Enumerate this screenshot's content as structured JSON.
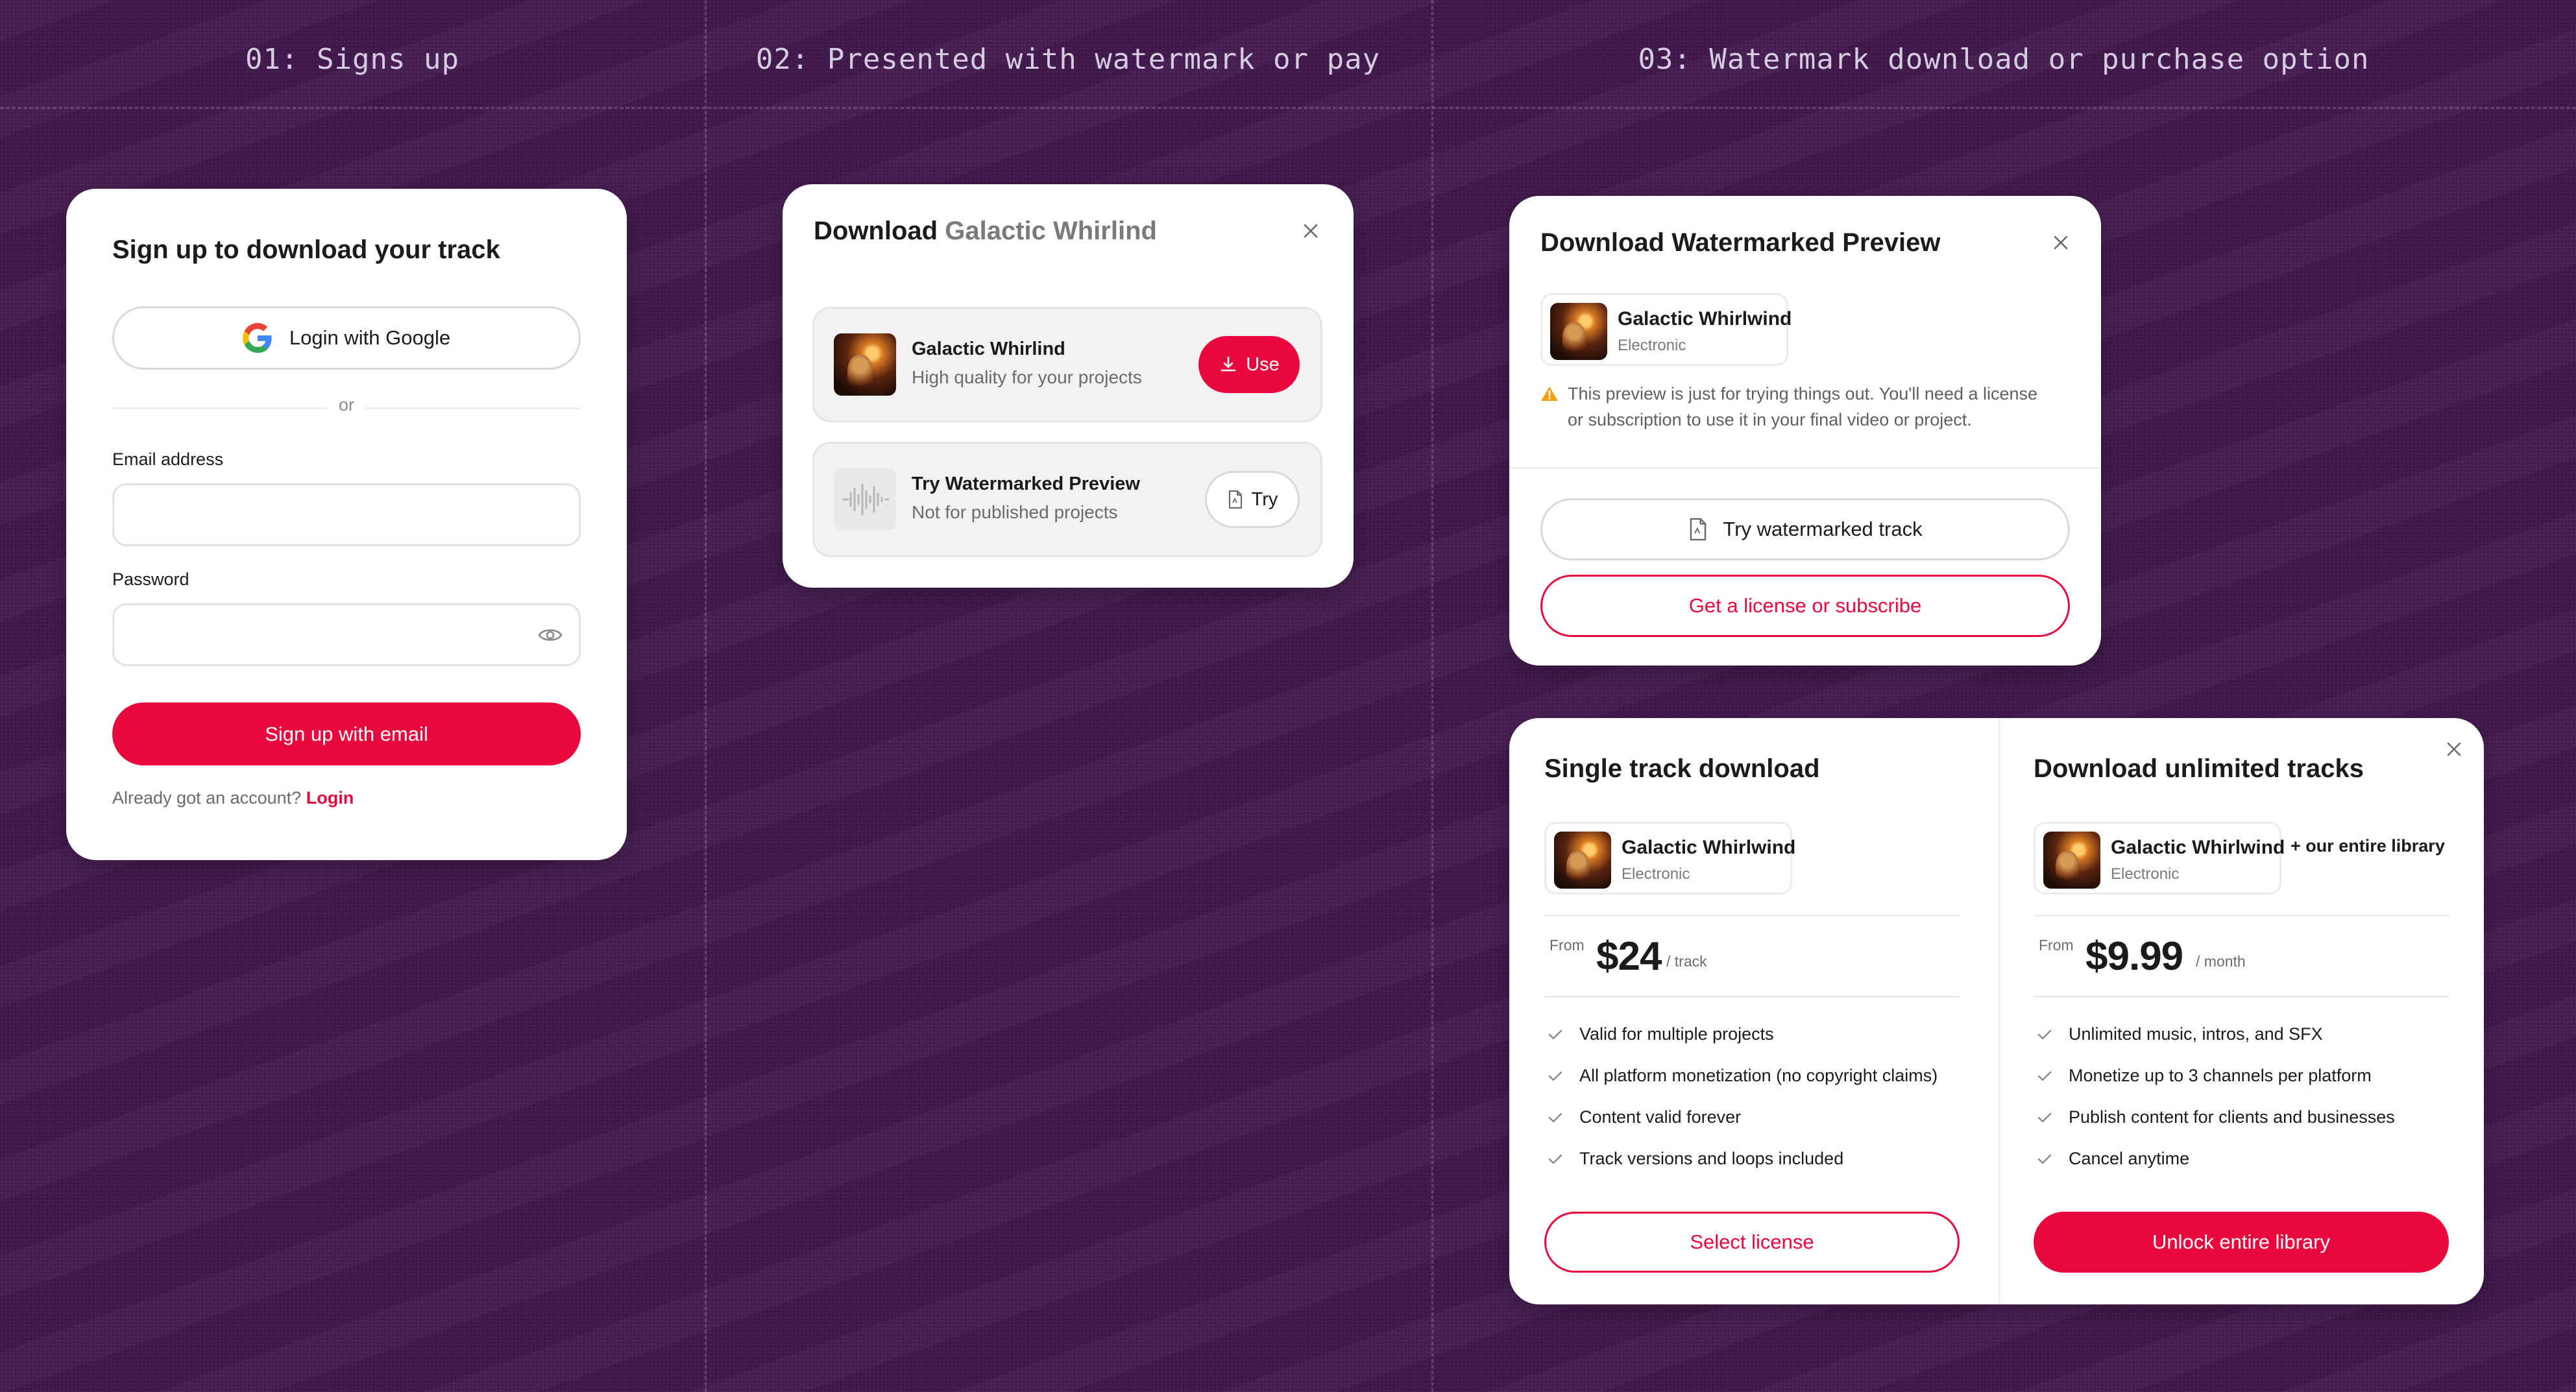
{
  "steps": [
    "01: Signs up",
    "02: Presented with watermark or pay",
    "03: Watermark download or purchase option"
  ],
  "signup": {
    "title": "Sign up to download your track",
    "google_label": "Login with Google",
    "or_label": "or",
    "email_label": "Email address",
    "email_value": "",
    "password_label": "Password",
    "password_value": "",
    "submit_label": "Sign up with email",
    "login_prompt": "Already got an account?",
    "login_link": "Login"
  },
  "download_modal": {
    "title_prefix": "Download",
    "title_track": "Galactic Whirlind",
    "options": [
      {
        "title": "Galactic Whirlind",
        "subtitle": "High quality for your projects",
        "button": "Use"
      },
      {
        "title": "Try Watermarked Preview",
        "subtitle": "Not for published projects",
        "button": "Try"
      }
    ]
  },
  "preview_modal": {
    "title": "Download Watermarked Preview",
    "track_title": "Galactic Whirlwind",
    "track_genre": "Electronic",
    "warning_line1": "This preview is just for trying things out. You'll need a license",
    "warning_line2": "or subscription to use it in your final video or project.",
    "try_button": "Try watermarked track",
    "license_button": "Get a license or subscribe"
  },
  "purchase_modal": {
    "single": {
      "title": "Single track download",
      "track_title": "Galactic Whirlwind",
      "track_genre": "Electronic",
      "price_from": "From",
      "price": "$24",
      "price_unit": "/ track",
      "features": [
        "Valid for multiple projects",
        "All platform monetization (no copyright claims)",
        "Content valid forever",
        "Track versions and loops included"
      ],
      "button": "Select license"
    },
    "unlimited": {
      "title": "Download unlimited tracks",
      "track_title": "Galactic Whirlwind",
      "track_genre": "Electronic",
      "library_note": "+ our entire library",
      "price_from": "From",
      "price": "$9.99",
      "price_unit": "/ month",
      "features": [
        "Unlimited music, intros, and SFX",
        "Monetize up to 3 channels per platform",
        "Publish content for clients and businesses",
        "Cancel anytime"
      ],
      "button": "Unlock entire library"
    }
  },
  "colors": {
    "background": "#421a4e",
    "accent": "#e8083e",
    "warning": "#f0a21a"
  },
  "icons": [
    "google-icon",
    "eye-icon",
    "close-icon",
    "download-icon",
    "document-icon",
    "warning-icon",
    "check-icon"
  ]
}
